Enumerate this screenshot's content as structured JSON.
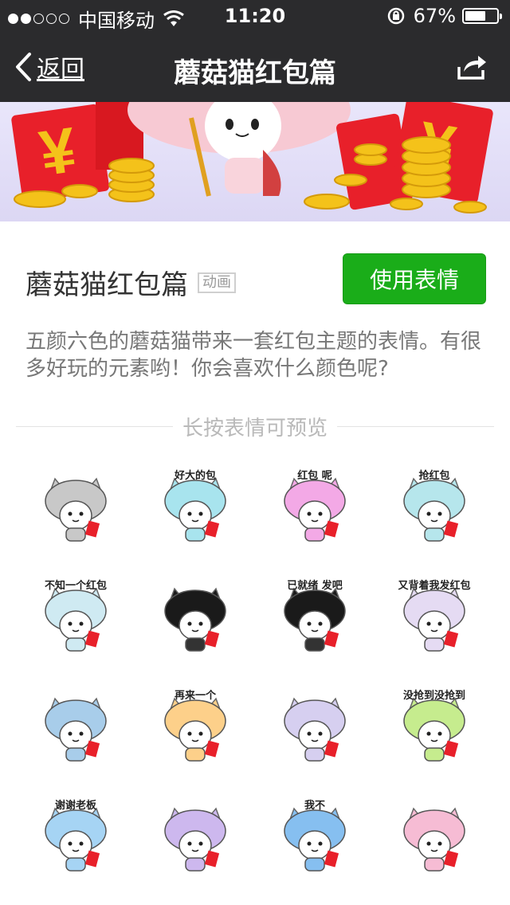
{
  "status": {
    "carrier": "中国移动",
    "time": "11:20",
    "battery": "67%",
    "battery_level": 0.67
  },
  "nav": {
    "back_label": "返回",
    "title": "蘑菇猫红包篇"
  },
  "info": {
    "title": "蘑菇猫红包篇",
    "tag": "动画",
    "use_button": "使用表情",
    "description": "五颜六色的蘑菇猫带来一套红包主题的表情。有很多好玩的元素哟！你会喜欢什么颜色呢?"
  },
  "preview_hint": "长按表情可预览",
  "colors": {
    "nav_bg": "#2b2b2d",
    "accent_green": "#1aad19",
    "red_packet": "#e8202a",
    "gold": "#f4c21a"
  },
  "stickers": [
    {
      "color": "#c8c8c8",
      "caption": ""
    },
    {
      "color": "#a8e4ee",
      "caption": "好大的包"
    },
    {
      "color": "#f3a9e6",
      "caption": "红包 呢"
    },
    {
      "color": "#b6e6ec",
      "caption": "抢红包"
    },
    {
      "color": "#cfeaf2",
      "caption": "不知一个红包"
    },
    {
      "color": "#1a1a1a",
      "caption": ""
    },
    {
      "color": "#1a1a1a",
      "caption": "已就绪 发吧"
    },
    {
      "color": "#e5dbf3",
      "caption": "又背着我发红包"
    },
    {
      "color": "#a8cdea",
      "caption": ""
    },
    {
      "color": "#fdd08a",
      "caption": "再来一个"
    },
    {
      "color": "#d6cff0",
      "caption": ""
    },
    {
      "color": "#c6ec8e",
      "caption": "没抢到没抢到"
    },
    {
      "color": "#a6d4f4",
      "caption": "谢谢老板"
    },
    {
      "color": "#cdb8ee",
      "caption": ""
    },
    {
      "color": "#86bff0",
      "caption": "我不"
    },
    {
      "color": "#f6bcd4",
      "caption": ""
    }
  ]
}
